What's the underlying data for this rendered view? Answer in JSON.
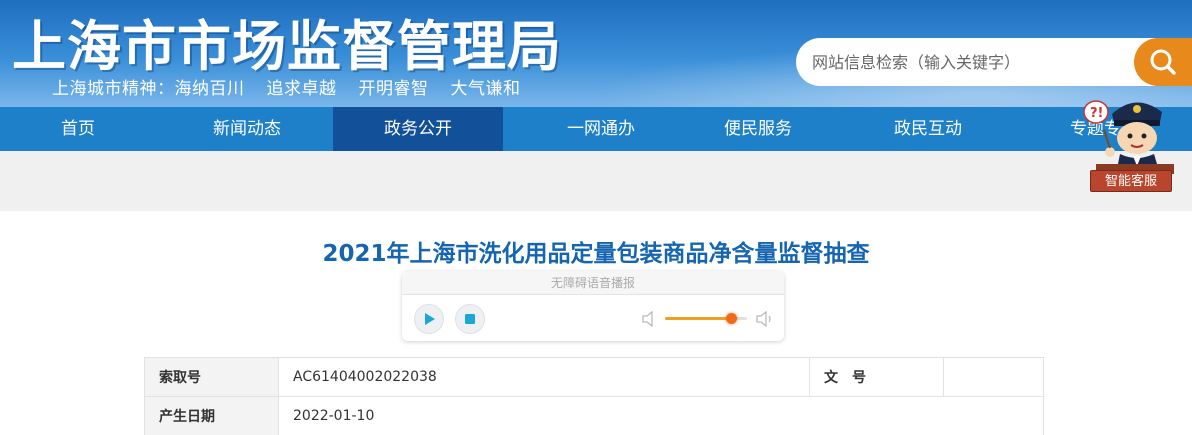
{
  "header": {
    "site_title": "上海市市场监督管理局",
    "motto": [
      "上海城市精神：海纳百川",
      "追求卓越",
      "开明睿智",
      "大气谦和"
    ],
    "search": {
      "placeholder": "网站信息检索（输入关键字）",
      "icon": "search-icon"
    }
  },
  "nav": {
    "items": [
      {
        "label": "首页",
        "active": false
      },
      {
        "label": "新闻动态",
        "active": false
      },
      {
        "label": "政务公开",
        "active": true
      },
      {
        "label": "一网通办",
        "active": false
      },
      {
        "label": "便民服务",
        "active": false
      },
      {
        "label": "政民互动",
        "active": false
      },
      {
        "label": "专题专栏",
        "active": false
      }
    ]
  },
  "robot": {
    "label": "智能客服",
    "icon": "customer-service-robot-icon"
  },
  "article": {
    "title": "2021年上海市洗化用品定量包装商品净含量监督抽查"
  },
  "player": {
    "header": "无障碍语音播报",
    "play_icon": "play-icon",
    "stop_icon": "stop-icon",
    "volume_icon": "volume-icon",
    "volume_level_fraction": 0.8
  },
  "info_table": {
    "rows": [
      {
        "label1": "索取号",
        "value1": "AC61404002022038",
        "label2": "文　号",
        "value2": ""
      },
      {
        "label1": "产生日期",
        "value1": "2022-01-10",
        "label2": "",
        "value2": ""
      }
    ]
  },
  "colors": {
    "banner_blue": "#1f6fc0",
    "nav_blue": "#1d80c8",
    "nav_active": "#12509a",
    "search_orange": "#e8891c",
    "title_blue": "#1565b0"
  }
}
